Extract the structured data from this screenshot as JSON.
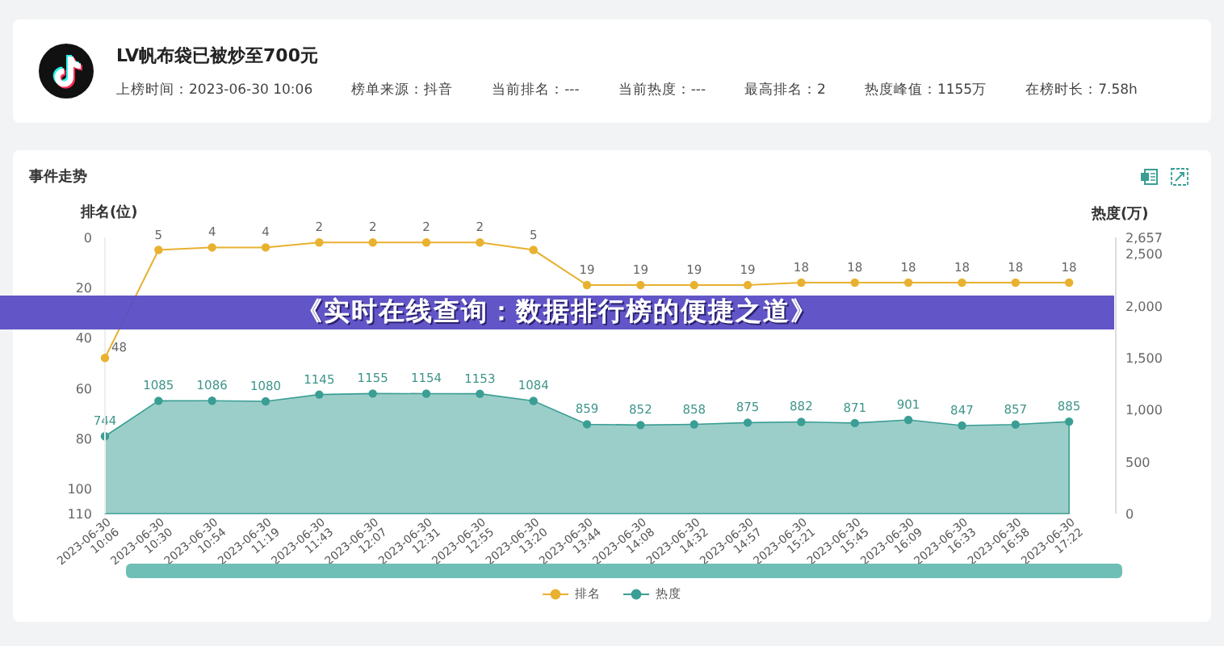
{
  "header": {
    "title": "LV帆布袋已被炒至700元",
    "meta": [
      "上榜时间：2023-06-30 10:06",
      "榜单来源：抖音",
      "当前排名：---",
      "当前热度：---",
      "最高排名：2",
      "热度峰值：1155万",
      "在榜时长：7.58h"
    ]
  },
  "trend": {
    "title": "事件走势",
    "rank_chart": {
      "chart_data": {
        "type": "line",
        "ylabel": "排名(位)",
        "ylim": [
          110,
          0
        ],
        "yticks": [
          0,
          20,
          40,
          60,
          80,
          100,
          110
        ],
        "data_labels": true,
        "x": [
          "2023-06-30 10:06",
          "2023-06-30 10:30",
          "2023-06-30 10:54",
          "2023-06-30 11:19",
          "2023-06-30 11:43",
          "2023-06-30 12:07",
          "2023-06-30 12:31",
          "2023-06-30 12:55",
          "2023-06-30 13:20",
          "2023-06-30 13:44",
          "2023-06-30 14:08",
          "2023-06-30 14:32",
          "2023-06-30 14:57",
          "2023-06-30 15:21",
          "2023-06-30 15:45",
          "2023-06-30 16:09",
          "2023-06-30 16:33",
          "2023-06-30 16:58",
          "2023-06-30 17:22"
        ],
        "series": [
          {
            "name": "排名",
            "color": "#e8b130",
            "marker": "circle",
            "values": [
              48,
              5,
              4,
              4,
              2,
              2,
              2,
              2,
              5,
              19,
              19,
              19,
              19,
              18,
              18,
              18,
              18,
              18,
              18
            ]
          }
        ]
      }
    },
    "heat_chart": {
      "chart_data": {
        "type": "area",
        "ylabel": "热度(万)",
        "ylim": [
          0,
          2657
        ],
        "yticks": [
          {
            "value": 2657,
            "label": "2,657"
          },
          {
            "value": 2500,
            "label": "2,500"
          },
          {
            "value": 2000,
            "label": "2,000"
          },
          {
            "value": 1500,
            "label": "1,500"
          },
          {
            "value": 1000,
            "label": "1,000"
          },
          {
            "value": 500,
            "label": "500"
          },
          {
            "value": 0,
            "label": "0"
          }
        ],
        "data_labels": true,
        "series": [
          {
            "name": "热度",
            "color": "#3a9e94",
            "marker": "circle",
            "values": [
              744,
              1085,
              1086,
              1080,
              1145,
              1155,
              1154,
              1153,
              1084,
              859,
              852,
              858,
              875,
              882,
              871,
              901,
              847,
              857,
              885
            ]
          }
        ]
      }
    }
  },
  "banner": {
    "text": "《实时在线查询：数据排行榜的便捷之道》"
  }
}
